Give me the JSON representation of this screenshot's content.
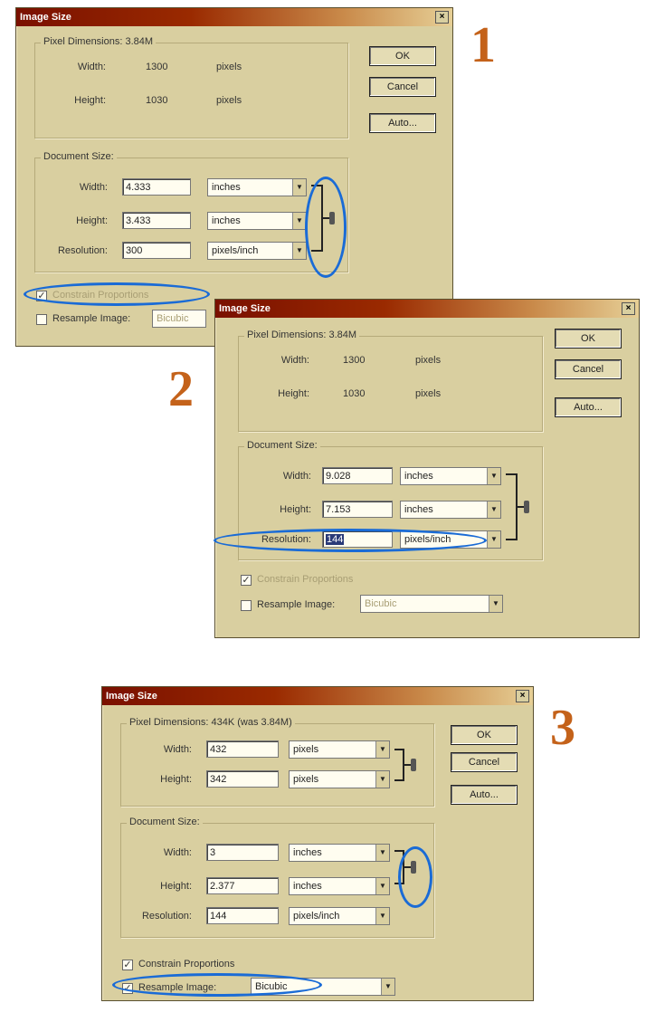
{
  "labels": {
    "step1": "1",
    "step2": "2",
    "step3": "3"
  },
  "dialogs": [
    {
      "title": "Image Size",
      "close": "×",
      "pixel_dimensions": "Pixel Dimensions: 3.84M",
      "pixel_width_label": "Width:",
      "pixel_width_value": "1300",
      "pixel_width_unit": "pixels",
      "pixel_height_label": "Height:",
      "pixel_height_value": "1030",
      "pixel_height_unit": "pixels",
      "document_size": "Document Size:",
      "width_label": "Width:",
      "width_value": "4.333",
      "width_unit": "inches",
      "height_label": "Height:",
      "height_value": "3.433",
      "height_unit": "inches",
      "resolution_label": "Resolution:",
      "resolution_value": "300",
      "resolution_unit": "pixels/inch",
      "constrain": "Constrain Proportions",
      "resample": "Resample Image:",
      "resample_value": "Bicubic",
      "ok": "OK",
      "cancel": "Cancel",
      "auto": "Auto..."
    },
    {
      "title": "Image Size",
      "close": "×",
      "pixel_dimensions": "Pixel Dimensions: 3.84M",
      "pixel_width_label": "Width:",
      "pixel_width_value": "1300",
      "pixel_width_unit": "pixels",
      "pixel_height_label": "Height:",
      "pixel_height_value": "1030",
      "pixel_height_unit": "pixels",
      "document_size": "Document Size:",
      "width_label": "Width:",
      "width_value": "9.028",
      "width_unit": "inches",
      "height_label": "Height:",
      "height_value": "7.153",
      "height_unit": "inches",
      "resolution_label": "Resolution:",
      "resolution_value": "144",
      "resolution_unit": "pixels/inch",
      "constrain": "Constrain Proportions",
      "resample": "Resample Image:",
      "resample_value": "Bicubic",
      "ok": "OK",
      "cancel": "Cancel",
      "auto": "Auto..."
    },
    {
      "title": "Image Size",
      "close": "×",
      "pixel_dimensions": "Pixel Dimensions: 434K (was 3.84M)",
      "pixel_width_label": "Width:",
      "pixel_width_value": "432",
      "pixel_width_unit": "pixels",
      "pixel_height_label": "Height:",
      "pixel_height_value": "342",
      "pixel_height_unit": "pixels",
      "document_size": "Document Size:",
      "width_label": "Width:",
      "width_value": "3",
      "width_unit": "inches",
      "height_label": "Height:",
      "height_value": "2.377",
      "height_unit": "inches",
      "resolution_label": "Resolution:",
      "resolution_value": "144",
      "resolution_unit": "pixels/inch",
      "constrain": "Constrain Proportions",
      "resample": "Resample Image:",
      "resample_value": "Bicubic",
      "ok": "OK",
      "cancel": "Cancel",
      "auto": "Auto..."
    }
  ],
  "colors": {
    "annotation_oval": "#1a6bd6",
    "step_number": "#c4621a",
    "dialog_bg": "#d9cfa0"
  }
}
